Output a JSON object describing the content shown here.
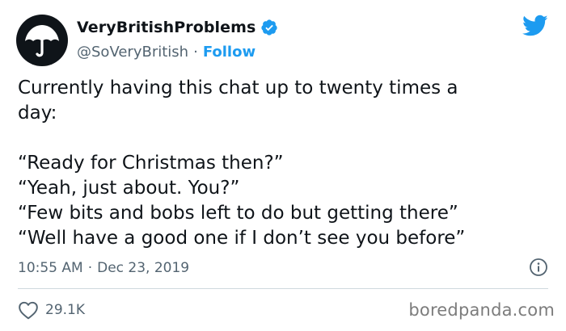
{
  "author": {
    "display_name": "VeryBritishProblems",
    "handle": "@SoVeryBritish",
    "separator": "·",
    "follow_label": "Follow",
    "verified": true
  },
  "tweet": {
    "text_line1": "Currently having this chat up to twenty times a",
    "text_line2": "day:",
    "quote1": "“Ready for Christmas then?”",
    "quote2": "“Yeah, just about. You?”",
    "quote3": "“Few bits and bobs left to do but getting there”",
    "quote4": "“Well have a good one if I don’t see you before”"
  },
  "meta": {
    "time": "10:55 AM",
    "separator": "·",
    "date": "Dec 23, 2019"
  },
  "engagement": {
    "likes": "29.1K"
  },
  "watermark": "boredpanda.com",
  "icons": {
    "avatar": "umbrella-logo",
    "verified": "verified-badge-icon",
    "brand": "twitter-bird-icon",
    "info": "info-icon",
    "like": "heart-icon"
  },
  "colors": {
    "accent": "#1d9bf0",
    "text": "#0f1419",
    "secondary": "#536471",
    "divider": "#cfd9de"
  }
}
